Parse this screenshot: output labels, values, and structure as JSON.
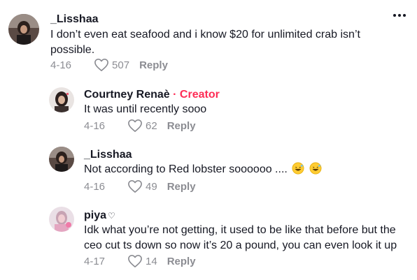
{
  "comments": [
    {
      "username": "_Lisshaa",
      "text": "I don’t even eat seafood and i know $20 for unlimited crab isn’t possible.",
      "date": "4-16",
      "likes": "507",
      "reply_label": "Reply"
    },
    {
      "username": "Courtney Renaè",
      "creator_label": " · Creator",
      "text": "It was until recently sooo",
      "date": "4-16",
      "likes": "62",
      "reply_label": "Reply"
    },
    {
      "username": "_Lisshaa",
      "text": "Not according to Red lobster soooooo ....",
      "date": "4-16",
      "likes": "49",
      "reply_label": "Reply"
    },
    {
      "username": "piya",
      "username_suffix": "♡",
      "text": "Idk what you’re not getting, it used to be like that before but the ceo cut ts down so now it’s 20 a pound, you can even look it up",
      "date": "4-17",
      "likes": "14",
      "reply_label": "Reply"
    }
  ],
  "icons": {
    "like": "heart-outline-icon",
    "more": "more-horizontal-icon",
    "emoji": "grinning-sweat-emoji"
  },
  "colors": {
    "creator": "#fe2c55",
    "meta": "#8a8b91",
    "text": "#161823"
  }
}
